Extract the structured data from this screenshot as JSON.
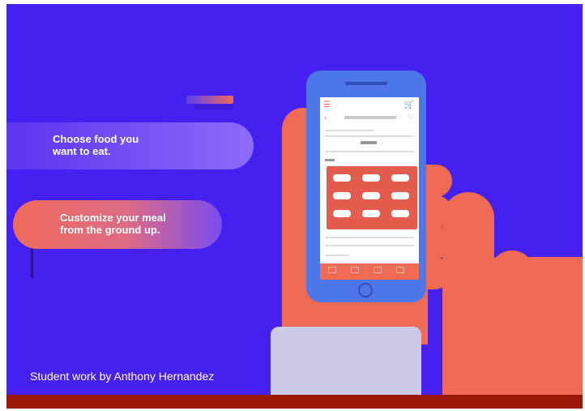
{
  "taglines": {
    "first": "Choose food you\nwant to eat.",
    "second": "Customize your meal\nfrom the ground up."
  },
  "credit": "Student work by Anthony Hernandez",
  "colors": {
    "background": "#4520f0",
    "accent": "#ef6a52",
    "phone_body": "#4d77e8",
    "sleeve": "#ccc8e8",
    "footer_bar": "#9a1808"
  },
  "icons": {
    "menu": "hamburger-icon",
    "cart": "cart-icon",
    "back": "back-arrow-icon"
  }
}
